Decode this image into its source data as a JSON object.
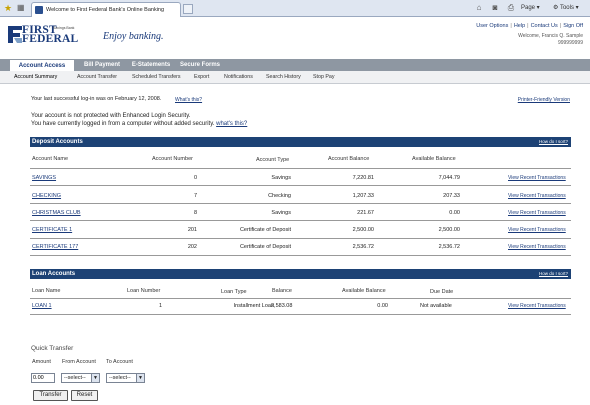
{
  "browser": {
    "tab_title": "Welcome to First Federal Bank's Online Banking",
    "toolbar_page": "Page",
    "toolbar_tools": "Tools"
  },
  "header": {
    "logo_line1": "FIRST",
    "logo_line2": "FEDERAL",
    "logo_sub": "Savings Bank",
    "tagline": "Enjoy banking.",
    "utility": [
      "User Options",
      "Help",
      "Contact Us",
      "Sign Off"
    ],
    "welcome": "Welcome, Francis Q. Sample",
    "account_id": "999999999"
  },
  "nav": {
    "tabs": [
      "Account Access",
      "Bill Payment",
      "E-Statements",
      "Secure Forms"
    ],
    "subnav": [
      "Account Summary",
      "Account Transfer",
      "Scheduled Transfers",
      "Export",
      "Notifications",
      "Search History",
      "Stop Pay"
    ]
  },
  "notices": {
    "last_login": "Your last successful log-in was on February 12, 2008.",
    "whats_this_1": "What's this?",
    "printer_friendly": "Printer-Friendly Version",
    "security_line1": "Your account is not protected with Enhanced Login Security.",
    "security_line2": "You have currently logged in from a computer without added security.",
    "whats_this_2": "what's this?"
  },
  "deposit": {
    "title": "Deposit Accounts",
    "sort": "How do I sort?",
    "headers": [
      "Account Name",
      "Account Number",
      "Account Type",
      "Account Balance",
      "Available Balance"
    ],
    "rows": [
      {
        "name": "SAVINGS",
        "number": "0",
        "type": "Savings",
        "balance": "7,220.81",
        "available": "7,044.79",
        "link": "View Recent Transactions"
      },
      {
        "name": "CHECKING",
        "number": "7",
        "type": "Checking",
        "balance": "1,207.33",
        "available": "207.33",
        "link": "View Recent Transactions"
      },
      {
        "name": "CHRISTMAS CLUB",
        "number": "8",
        "type": "Savings",
        "balance": "221.67",
        "available": "0.00",
        "link": "View Recent Transactions"
      },
      {
        "name": "CERTIFICATE 1",
        "number": "201",
        "type": "Certificate of Deposit",
        "balance": "2,500.00",
        "available": "2,500.00",
        "link": "View Recent Transactions"
      },
      {
        "name": "CERTIFICATE 177",
        "number": "202",
        "type": "Certificate of Deposit",
        "balance": "2,536.72",
        "available": "2,536.72",
        "link": "View Recent Transactions"
      }
    ]
  },
  "loan": {
    "title": "Loan Accounts",
    "sort": "How do I sort?",
    "headers": [
      "Loan Name",
      "Loan Number",
      "Loan Type",
      "Balance",
      "Available Balance",
      "Due Date"
    ],
    "rows": [
      {
        "name": "LOAN 1",
        "number": "1",
        "type": "Installment Loan",
        "balance": "2,583.08",
        "available": "0.00",
        "due": "Not available",
        "link": "View Recent Transactions"
      }
    ]
  },
  "quick_transfer": {
    "title": "Quick Transfer",
    "amount_label": "Amount",
    "from_label": "From Account",
    "to_label": "To Account",
    "amount_value": "0.00",
    "from_value": "--select--",
    "to_value": "--select--",
    "transfer_button": "Transfer",
    "reset_button": "Reset"
  },
  "colors": {
    "brand_navy": "#1d4275",
    "nav_gray": "#8e97a2",
    "link_blue": "#1a3a7a"
  }
}
